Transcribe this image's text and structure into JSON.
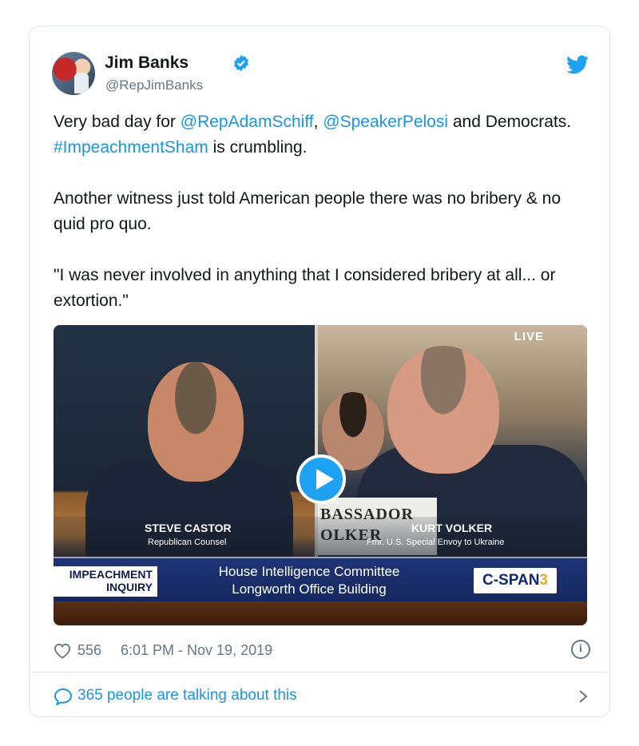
{
  "author": {
    "name": "Jim Banks",
    "handle": "@RepJimBanks",
    "verified": true
  },
  "tweet": {
    "line1_prefix": "Very bad day for ",
    "mention1": "@RepAdamSchiff",
    "sep1": ", ",
    "mention2": "@SpeakerPelosi",
    "line1_suffix": " and Democrats. ",
    "hashtag": "#ImpeachmentSham",
    "line1_end": " is crumbling.",
    "para2": "Another witness just told American people there was no bribery & no quid pro quo.",
    "para3": "\"I was never involved in anything that I considered bribery at all... or extortion.\""
  },
  "video": {
    "live_label": "LIVE",
    "left_name": "STEVE CASTOR",
    "left_role": "Republican Counsel",
    "right_name": "KURT VOLKER",
    "right_role": "Fmr. U.S. Special Envoy to Ukraine",
    "placard_text": "BASSADOR OLKER",
    "inquiry_line1": "IMPEACHMENT",
    "inquiry_line2": "INQUIRY",
    "committee_line1": "House Intelligence Committee",
    "committee_line2": "Longworth Office Building",
    "network_main": "C-SPAN",
    "network_num": "3"
  },
  "meta": {
    "likes": "556",
    "timestamp": "6:01 PM - Nov 19, 2019",
    "info_glyph": "i"
  },
  "footer": {
    "talking": "365 people are talking about this"
  },
  "colors": {
    "link": "#1b95e0",
    "muted": "#657786",
    "twitter_blue": "#1da1f2"
  }
}
